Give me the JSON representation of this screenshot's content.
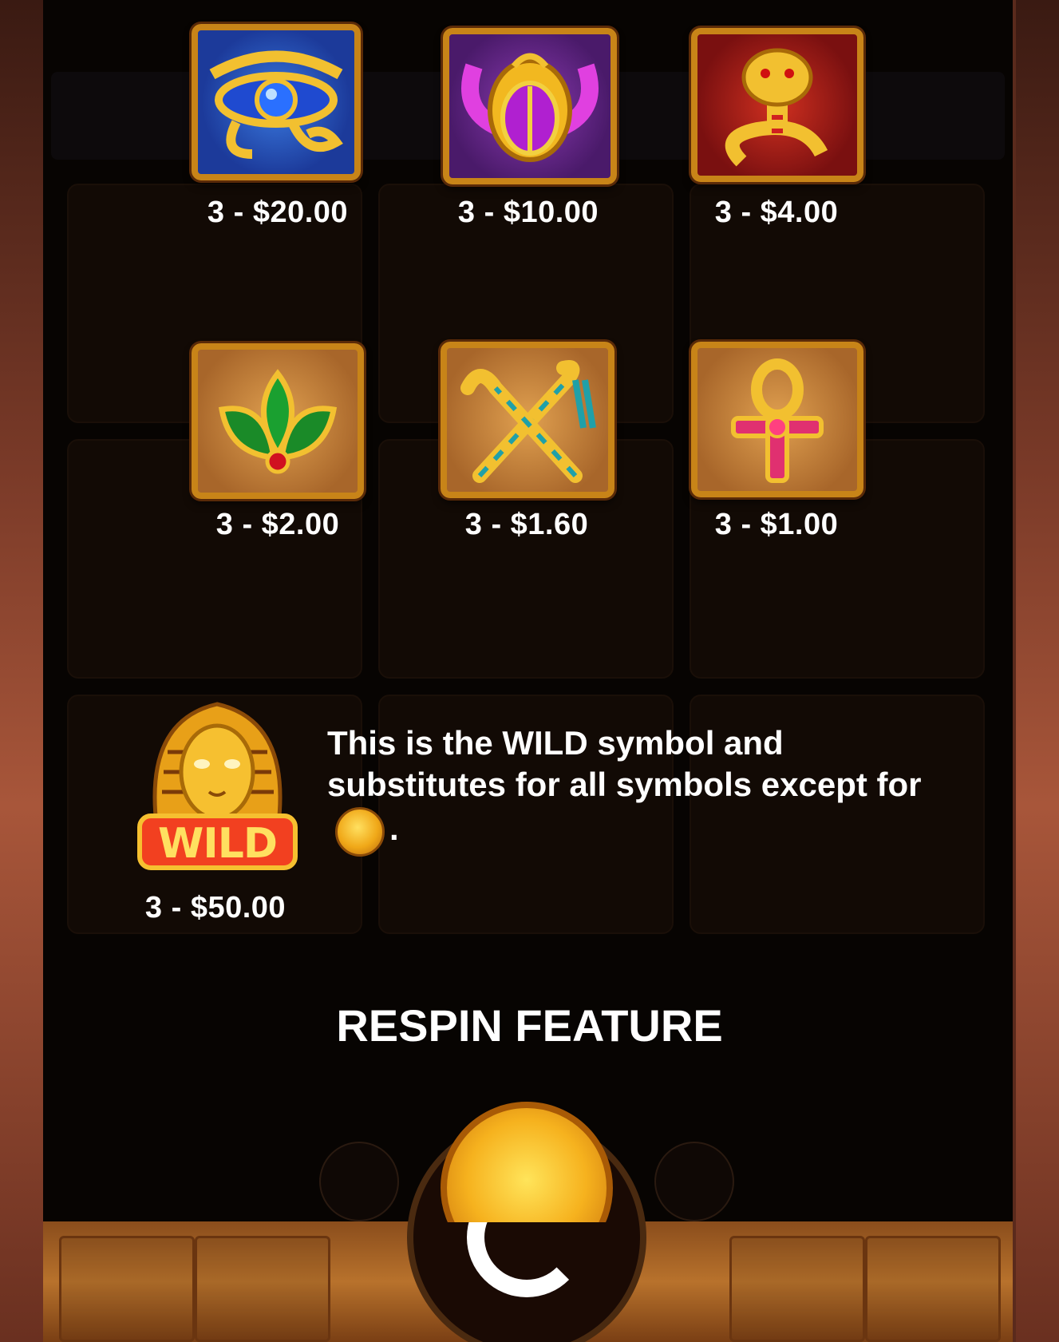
{
  "paytable": {
    "symbols": [
      {
        "icon": "eye-of-horus-icon",
        "payout": "3 - $20.00"
      },
      {
        "icon": "scarab-icon",
        "payout": "3 - $10.00"
      },
      {
        "icon": "cobra-icon",
        "payout": "3 - $4.00"
      },
      {
        "icon": "lotus-icon",
        "payout": "3 - $2.00"
      },
      {
        "icon": "crook-and-flail-icon",
        "payout": "3 - $1.60"
      },
      {
        "icon": "ankh-icon",
        "payout": "3 - $1.00"
      }
    ],
    "wild": {
      "icon": "pharaoh-wild-icon",
      "label": "WILD",
      "payout": "3 - $50.00",
      "description": "This is the WILD symbol and substitutes for all symbols except for",
      "description_end": "."
    }
  },
  "respin": {
    "title": "RESPIN FEATURE",
    "coin_icon": "gold-coin-icon"
  },
  "colors": {
    "panel_bg": "#070402",
    "gold_frame": "#c88418",
    "text": "#ffffff"
  }
}
